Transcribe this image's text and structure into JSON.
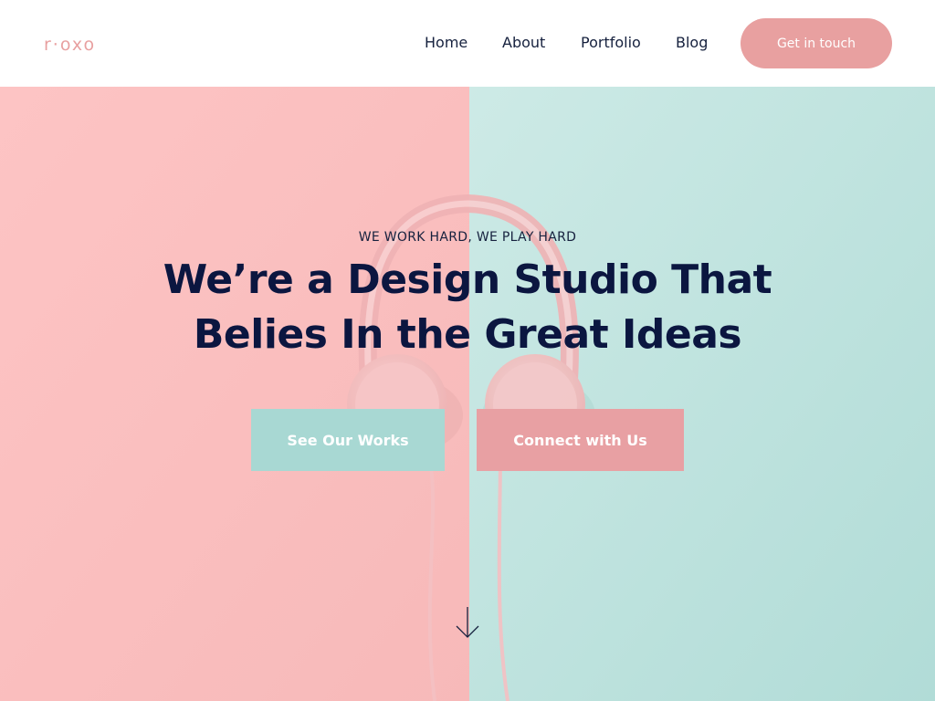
{
  "header": {
    "logo": "r·oxo",
    "nav": [
      {
        "label": "Home"
      },
      {
        "label": "About"
      },
      {
        "label": "Portfolio"
      },
      {
        "label": "Blog"
      }
    ],
    "cta_label": "Get in touch"
  },
  "hero": {
    "eyebrow": "WE WORK HARD, WE PLAY HARD",
    "headline_line1": "We’re a Design Studio That",
    "headline_line2": "Belies In the Great Ideas",
    "primary_button": "See Our Works",
    "secondary_button": "Connect with Us",
    "scroll_icon": "arrow-down-icon"
  },
  "colors": {
    "brand_pink": "#e8a0a0",
    "mint": "#a8d8d3",
    "navy": "#0b1640",
    "pink_bg": "#fbc3c3",
    "mint_bg": "#c8e8e4"
  }
}
